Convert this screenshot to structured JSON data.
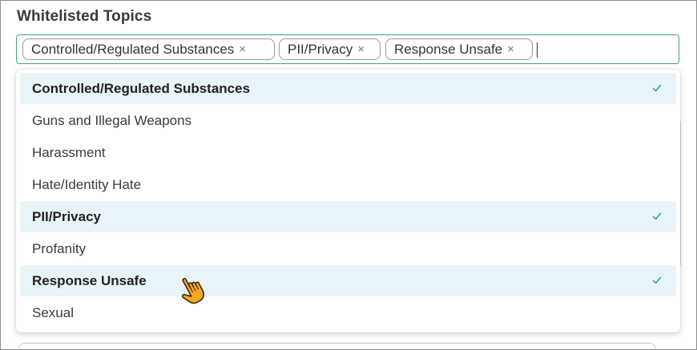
{
  "header": {
    "title": "Whitelisted Topics"
  },
  "tag_input": {
    "tags": [
      {
        "label": "Controlled/Regulated Substances",
        "remove_glyph": "×"
      },
      {
        "label": "PII/Privacy",
        "remove_glyph": "×"
      },
      {
        "label": "Response Unsafe",
        "remove_glyph": "×"
      }
    ],
    "accent_color": "#3aa58e"
  },
  "dropdown": {
    "options": [
      {
        "label": "Controlled/Regulated Substances",
        "selected": true
      },
      {
        "label": "Guns and Illegal Weapons",
        "selected": false
      },
      {
        "label": "Harassment",
        "selected": false
      },
      {
        "label": "Hate/Identity Hate",
        "selected": false
      },
      {
        "label": "PII/Privacy",
        "selected": true
      },
      {
        "label": "Profanity",
        "selected": false
      },
      {
        "label": "Response Unsafe",
        "selected": true
      },
      {
        "label": "Sexual",
        "selected": false
      }
    ],
    "selected_bg": "#e9f4f8",
    "check_color": "#2f8f86"
  },
  "cursor": {
    "icon": "hand-pointer-icon",
    "color": "#f5a623"
  }
}
